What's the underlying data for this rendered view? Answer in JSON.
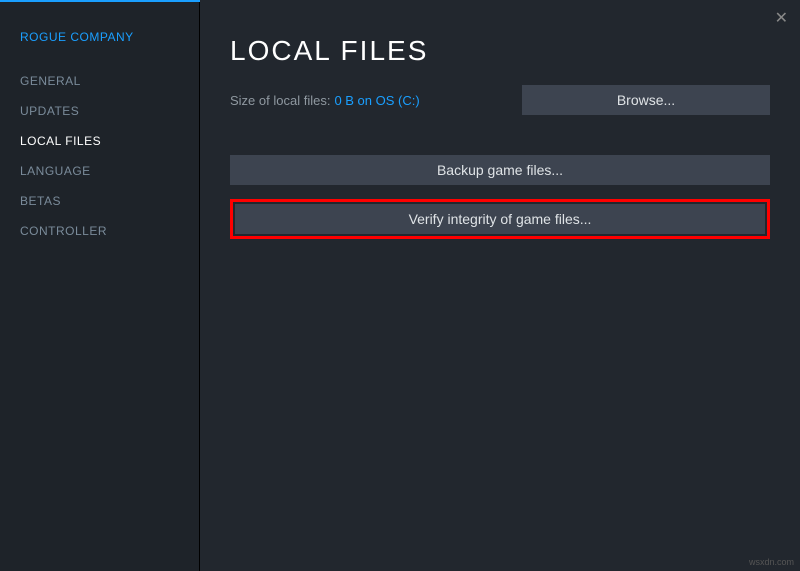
{
  "game_title": "ROGUE COMPANY",
  "sidebar": {
    "items": [
      {
        "label": "GENERAL",
        "active": false
      },
      {
        "label": "UPDATES",
        "active": false
      },
      {
        "label": "LOCAL FILES",
        "active": true
      },
      {
        "label": "LANGUAGE",
        "active": false
      },
      {
        "label": "BETAS",
        "active": false
      },
      {
        "label": "CONTROLLER",
        "active": false
      }
    ]
  },
  "main": {
    "title": "LOCAL FILES",
    "size_label": "Size of local files:",
    "size_value": "0 B on OS (C:)",
    "browse_label": "Browse...",
    "backup_label": "Backup game files...",
    "verify_label": "Verify integrity of game files..."
  },
  "watermark": "wsxdn.com"
}
